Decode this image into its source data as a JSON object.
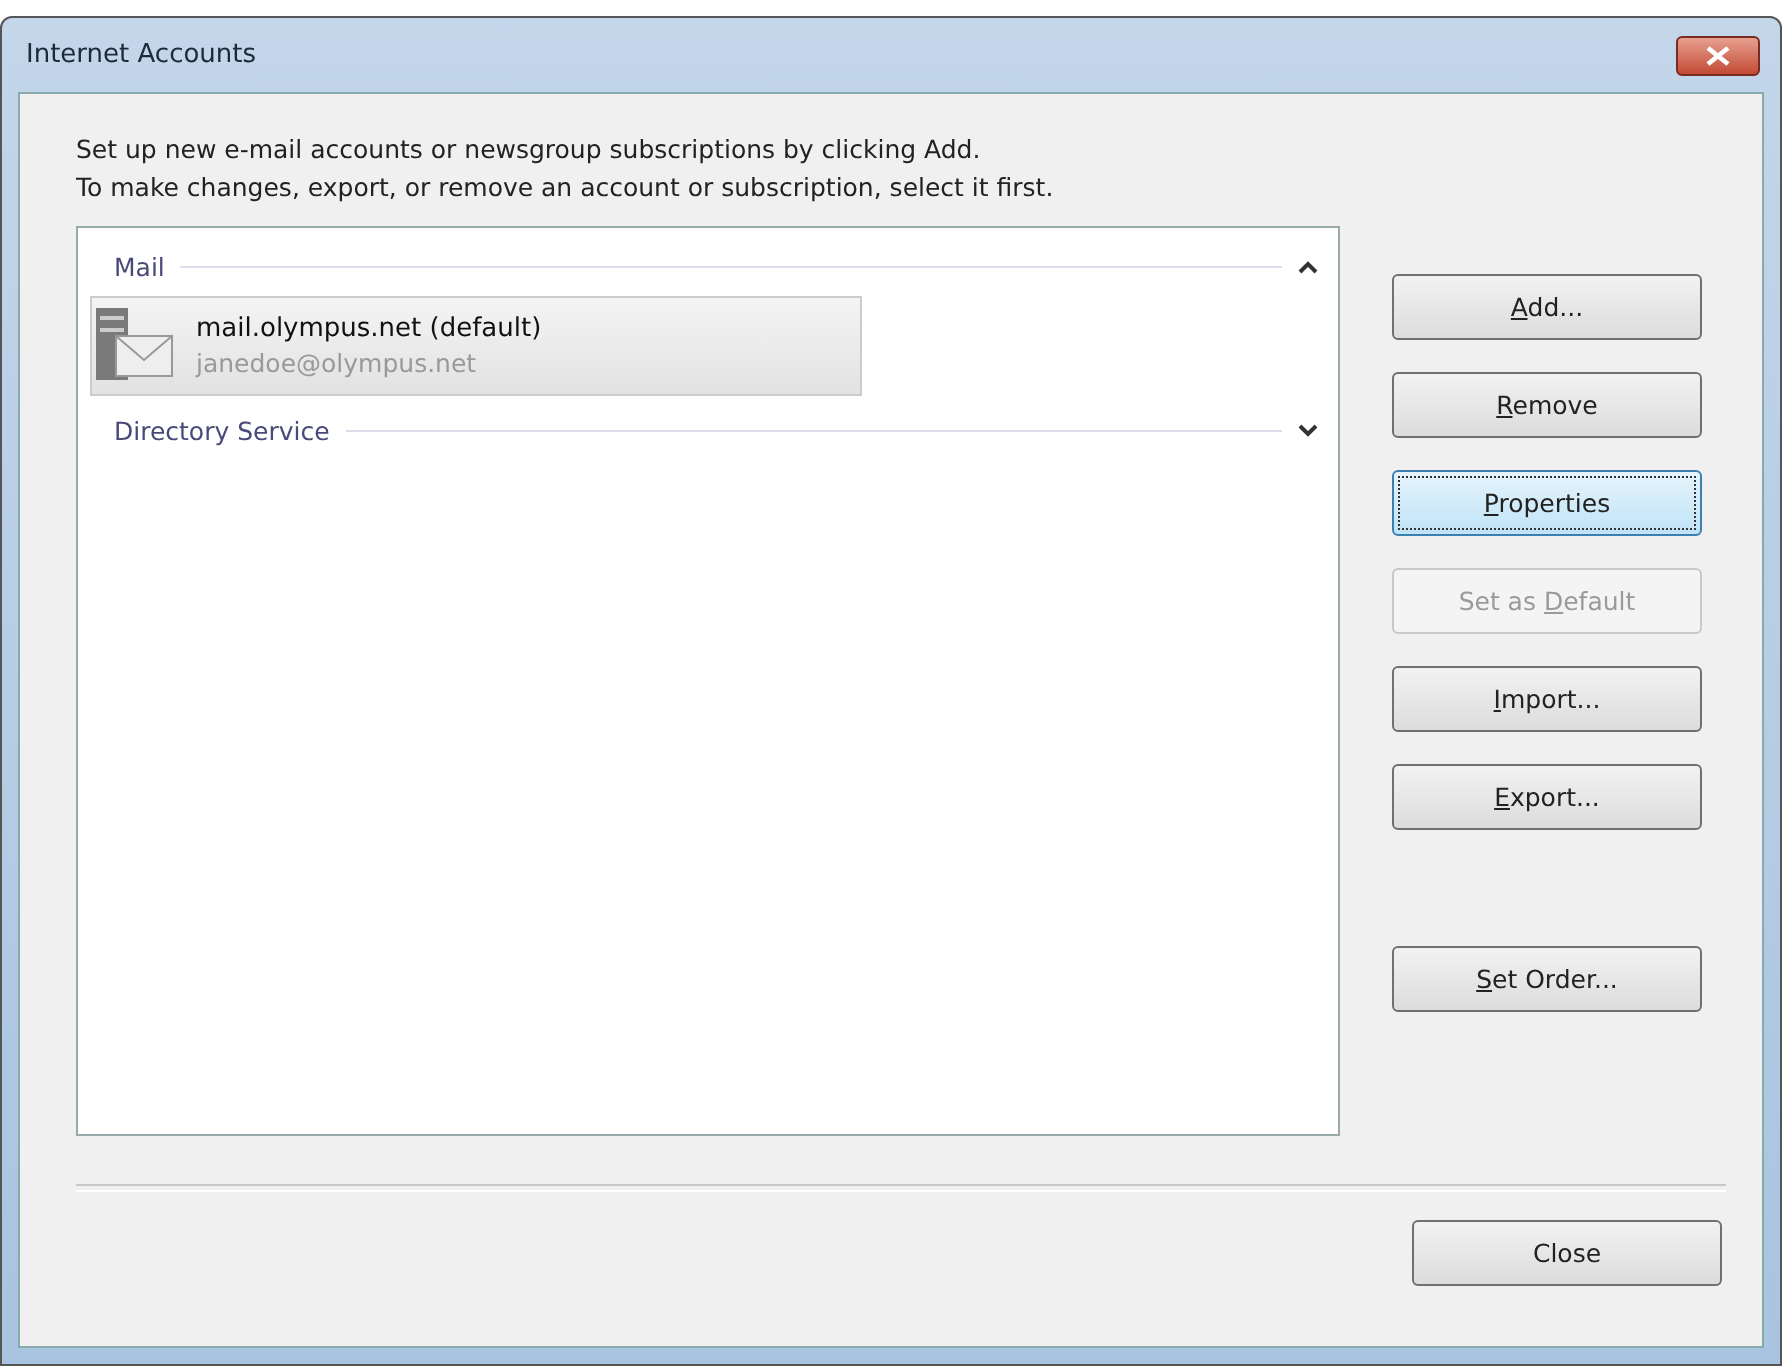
{
  "window": {
    "title": "Internet Accounts"
  },
  "intro": [
    "Set up new e-mail accounts or newsgroup subscriptions by clicking Add.",
    "To make changes, export, or remove an account or subscription, select it first."
  ],
  "groups": [
    {
      "name": "Mail",
      "expanded": true,
      "accounts": [
        {
          "name": "mail.olympus.net (default)",
          "email": "janedoe@olympus.net",
          "selected": true
        }
      ]
    },
    {
      "name": "Directory Service",
      "expanded": false
    }
  ],
  "buttons": [
    {
      "key": "A",
      "after": "dd...",
      "focused": false,
      "disabled": false
    },
    {
      "key": "R",
      "after": "emove",
      "focused": false,
      "disabled": false
    },
    {
      "key": "P",
      "after": "roperties",
      "focused": true,
      "disabled": false
    },
    {
      "before": "Set as ",
      "key": "D",
      "after": "efault",
      "focused": false,
      "disabled": true
    },
    {
      "key": "I",
      "after": "mport...",
      "focused": false,
      "disabled": false
    },
    {
      "key": "E",
      "after": "xport...",
      "focused": false,
      "disabled": false
    }
  ],
  "order_button": {
    "key": "S",
    "after": "et Order...",
    "focused": false,
    "disabled": false
  },
  "close_button": {
    "after": "Close",
    "focused": false,
    "disabled": false
  }
}
